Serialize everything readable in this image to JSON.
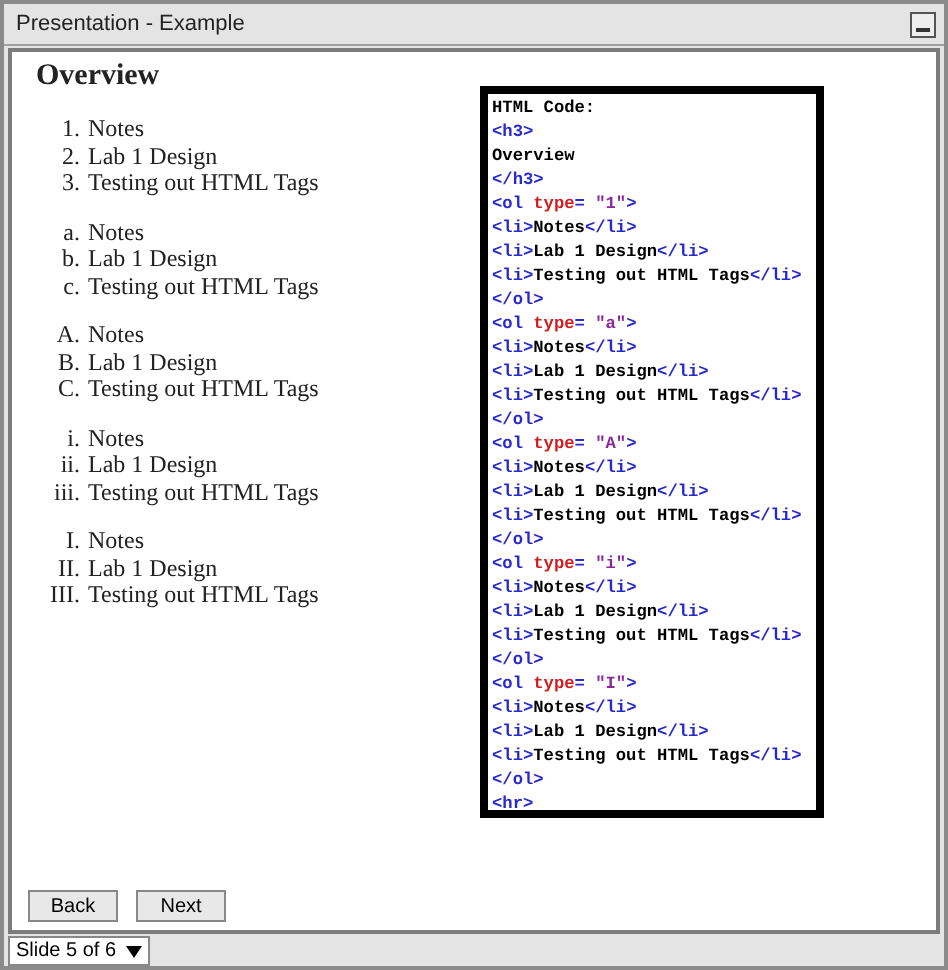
{
  "window": {
    "title": "Presentation - Example"
  },
  "heading": "Overview",
  "lists": [
    {
      "items": [
        {
          "marker": "1.",
          "text": "Notes"
        },
        {
          "marker": "2.",
          "text": "Lab 1 Design"
        },
        {
          "marker": "3.",
          "text": "Testing out HTML Tags"
        }
      ]
    },
    {
      "items": [
        {
          "marker": "a.",
          "text": "Notes"
        },
        {
          "marker": "b.",
          "text": "Lab 1 Design"
        },
        {
          "marker": "c.",
          "text": "Testing out HTML Tags"
        }
      ]
    },
    {
      "items": [
        {
          "marker": "A.",
          "text": "Notes"
        },
        {
          "marker": "B.",
          "text": "Lab 1 Design"
        },
        {
          "marker": "C.",
          "text": "Testing out HTML Tags"
        }
      ]
    },
    {
      "items": [
        {
          "marker": "i.",
          "text": "Notes"
        },
        {
          "marker": "ii.",
          "text": "Lab 1 Design"
        },
        {
          "marker": "iii.",
          "text": "Testing out HTML Tags"
        }
      ]
    },
    {
      "items": [
        {
          "marker": "I.",
          "text": "Notes"
        },
        {
          "marker": "II.",
          "text": "Lab 1 Design"
        },
        {
          "marker": "III.",
          "text": "Testing out HTML Tags"
        }
      ]
    }
  ],
  "code": [
    [
      {
        "kind": "text",
        "text": "HTML Code:"
      }
    ],
    [
      {
        "kind": "tag",
        "text": "<h3>"
      }
    ],
    [
      {
        "kind": "text",
        "text": "Overview"
      }
    ],
    [
      {
        "kind": "tag",
        "text": "</h3>"
      }
    ],
    [
      {
        "kind": "tag",
        "text": "<ol "
      },
      {
        "kind": "attr",
        "text": "type"
      },
      {
        "kind": "tag",
        "text": "= "
      },
      {
        "kind": "value",
        "text": "\"1\""
      },
      {
        "kind": "tag",
        "text": ">"
      }
    ],
    [
      {
        "kind": "tag",
        "text": "<li>"
      },
      {
        "kind": "text",
        "text": "Notes"
      },
      {
        "kind": "tag",
        "text": "</li>"
      }
    ],
    [
      {
        "kind": "tag",
        "text": "<li>"
      },
      {
        "kind": "text",
        "text": "Lab 1 Design"
      },
      {
        "kind": "tag",
        "text": "</li>"
      }
    ],
    [
      {
        "kind": "tag",
        "text": "<li>"
      },
      {
        "kind": "text",
        "text": "Testing out HTML Tags"
      },
      {
        "kind": "tag",
        "text": "</li>"
      }
    ],
    [
      {
        "kind": "tag",
        "text": "</ol>"
      }
    ],
    [
      {
        "kind": "tag",
        "text": "<ol "
      },
      {
        "kind": "attr",
        "text": "type"
      },
      {
        "kind": "tag",
        "text": "= "
      },
      {
        "kind": "value",
        "text": "\"a\""
      },
      {
        "kind": "tag",
        "text": ">"
      }
    ],
    [
      {
        "kind": "tag",
        "text": "<li>"
      },
      {
        "kind": "text",
        "text": "Notes"
      },
      {
        "kind": "tag",
        "text": "</li>"
      }
    ],
    [
      {
        "kind": "tag",
        "text": "<li>"
      },
      {
        "kind": "text",
        "text": "Lab 1 Design"
      },
      {
        "kind": "tag",
        "text": "</li>"
      }
    ],
    [
      {
        "kind": "tag",
        "text": "<li>"
      },
      {
        "kind": "text",
        "text": "Testing out HTML Tags"
      },
      {
        "kind": "tag",
        "text": "</li>"
      }
    ],
    [
      {
        "kind": "tag",
        "text": "</ol>"
      }
    ],
    [
      {
        "kind": "tag",
        "text": "<ol "
      },
      {
        "kind": "attr",
        "text": "type"
      },
      {
        "kind": "tag",
        "text": "= "
      },
      {
        "kind": "value",
        "text": "\"A\""
      },
      {
        "kind": "tag",
        "text": ">"
      }
    ],
    [
      {
        "kind": "tag",
        "text": "<li>"
      },
      {
        "kind": "text",
        "text": "Notes"
      },
      {
        "kind": "tag",
        "text": "</li>"
      }
    ],
    [
      {
        "kind": "tag",
        "text": "<li>"
      },
      {
        "kind": "text",
        "text": "Lab 1 Design"
      },
      {
        "kind": "tag",
        "text": "</li>"
      }
    ],
    [
      {
        "kind": "tag",
        "text": "<li>"
      },
      {
        "kind": "text",
        "text": "Testing out HTML Tags"
      },
      {
        "kind": "tag",
        "text": "</li>"
      }
    ],
    [
      {
        "kind": "tag",
        "text": "</ol>"
      }
    ],
    [
      {
        "kind": "tag",
        "text": "<ol "
      },
      {
        "kind": "attr",
        "text": "type"
      },
      {
        "kind": "tag",
        "text": "= "
      },
      {
        "kind": "value",
        "text": "\"i\""
      },
      {
        "kind": "tag",
        "text": ">"
      }
    ],
    [
      {
        "kind": "tag",
        "text": "<li>"
      },
      {
        "kind": "text",
        "text": "Notes"
      },
      {
        "kind": "tag",
        "text": "</li>"
      }
    ],
    [
      {
        "kind": "tag",
        "text": "<li>"
      },
      {
        "kind": "text",
        "text": "Lab 1 Design"
      },
      {
        "kind": "tag",
        "text": "</li>"
      }
    ],
    [
      {
        "kind": "tag",
        "text": "<li>"
      },
      {
        "kind": "text",
        "text": "Testing out HTML Tags"
      },
      {
        "kind": "tag",
        "text": "</li>"
      }
    ],
    [
      {
        "kind": "tag",
        "text": "</ol>"
      }
    ],
    [
      {
        "kind": "tag",
        "text": "<ol "
      },
      {
        "kind": "attr",
        "text": "type"
      },
      {
        "kind": "tag",
        "text": "= "
      },
      {
        "kind": "value",
        "text": "\"I\""
      },
      {
        "kind": "tag",
        "text": ">"
      }
    ],
    [
      {
        "kind": "tag",
        "text": "<li>"
      },
      {
        "kind": "text",
        "text": "Notes"
      },
      {
        "kind": "tag",
        "text": "</li>"
      }
    ],
    [
      {
        "kind": "tag",
        "text": "<li>"
      },
      {
        "kind": "text",
        "text": "Lab 1 Design"
      },
      {
        "kind": "tag",
        "text": "</li>"
      }
    ],
    [
      {
        "kind": "tag",
        "text": "<li>"
      },
      {
        "kind": "text",
        "text": "Testing out HTML Tags"
      },
      {
        "kind": "tag",
        "text": "</li>"
      }
    ],
    [
      {
        "kind": "tag",
        "text": "</ol>"
      }
    ],
    [
      {
        "kind": "tag",
        "text": "<hr>"
      }
    ]
  ],
  "buttons": [
    "Back",
    "Next"
  ],
  "status_bar": {
    "slide": "Slide 5 of 6"
  }
}
